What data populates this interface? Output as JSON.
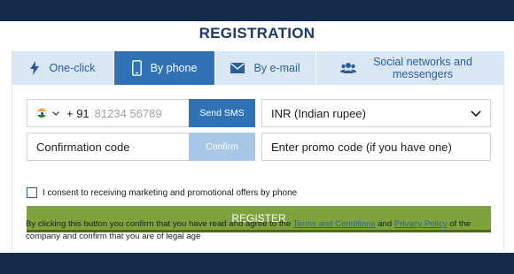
{
  "title": "REGISTRATION",
  "tabs": [
    {
      "label": "One-click",
      "icon": "lightning-icon",
      "active": false
    },
    {
      "label": "By phone",
      "icon": "phone-icon",
      "active": true
    },
    {
      "label": "By e-mail",
      "icon": "envelope-icon",
      "active": false
    },
    {
      "label": "Social networks and messengers",
      "icon": "users-icon",
      "active": false
    }
  ],
  "phone": {
    "country_code": "+ 91",
    "placeholder": "81234 56789",
    "flag": "india-flag-icon"
  },
  "send_sms_label": "Send SMS",
  "currency": {
    "value": "INR (Indian rupee)"
  },
  "confirmation_code": {
    "placeholder": "Confirmation code"
  },
  "confirm_label": "Confirm",
  "promo": {
    "placeholder": "Enter promo code (if you have one)"
  },
  "consent_label": "I consent to receiving marketing and promotional offers by phone",
  "register_label": "REGISTER",
  "legal": {
    "part1": "By clicking this button you confirm that you have read and agree to the ",
    "terms_link": "Terms and Conditions",
    "and": " and ",
    "privacy_link": "Privacy Policy",
    "part2": " of the company and confirm that you are of legal age"
  },
  "colors": {
    "background": "#132d4a",
    "primary": "#2f72b6",
    "tab_bg": "#d9e7f4",
    "register": "#7ea33e",
    "title": "#1c3b66"
  }
}
